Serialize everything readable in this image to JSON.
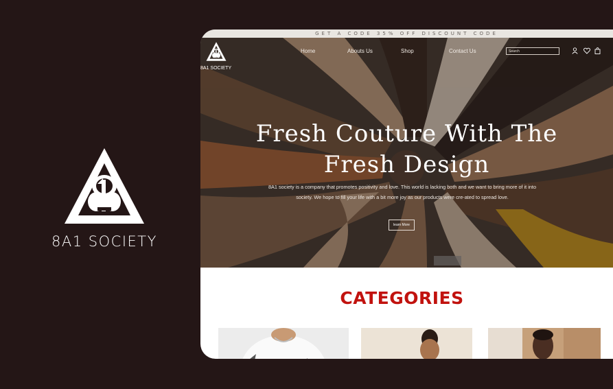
{
  "brand": {
    "name": "8A1 SOCIETY",
    "logo_icon": "triangle-81-logo-icon"
  },
  "site": {
    "promo": "GET A CODE 35% OFF DISCOUNT CODE",
    "logo_text": "8A1 SOCIETY",
    "nav": [
      "Home",
      "Abouts Us",
      "Shop",
      "Contact Us"
    ],
    "search_placeholder": "Search",
    "icons": [
      "user-icon",
      "heart-icon",
      "bag-icon"
    ],
    "hero": {
      "title_line1": "Fresh Couture With The",
      "title_line2": "Fresh Design",
      "description": "8A1 society is a company that promotes positivity and love. This world is lacking both and we want to bring more of it into society. We hope to fill your life with a bit more joy as our products were cre-ated to spread love.",
      "button": "learn More"
    },
    "categories_title": "CATEGORIES"
  },
  "colors": {
    "background": "#241616",
    "accent": "#c1120e"
  }
}
